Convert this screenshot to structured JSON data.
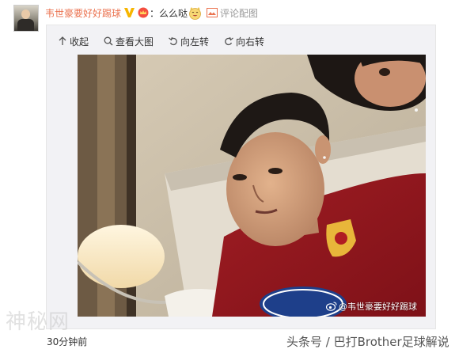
{
  "post": {
    "username": "韦世豪要好好踢球",
    "text": "么么哒",
    "colon": "：",
    "comment_link": "评论配图",
    "timestamp": "30分钟前"
  },
  "toolbar": {
    "collapse_label": "收起",
    "view_large_label": "查看大图",
    "rotate_left_label": "向左转",
    "rotate_right_label": "向右转"
  },
  "photo": {
    "watermark_text": "@韦世豪要好好踢球"
  },
  "overlay": {
    "ghost_watermark": "神秘网",
    "credit": "头条号 / 巴打Brother足球解说"
  },
  "colors": {
    "username": "#eb7350",
    "verified": "#f7b500",
    "vip": "#f44e3f",
    "panel_bg": "#f2f2f5"
  },
  "icons": {
    "verified": "verified-v-icon",
    "vip": "vip-crown-icon",
    "emoji": "grin-emoji-icon",
    "comment": "comment-image-icon",
    "collapse": "collapse-arrow-icon",
    "zoom": "magnifier-icon",
    "rotate_left": "rotate-left-icon",
    "rotate_right": "rotate-right-icon",
    "weibo": "weibo-logo-icon"
  }
}
